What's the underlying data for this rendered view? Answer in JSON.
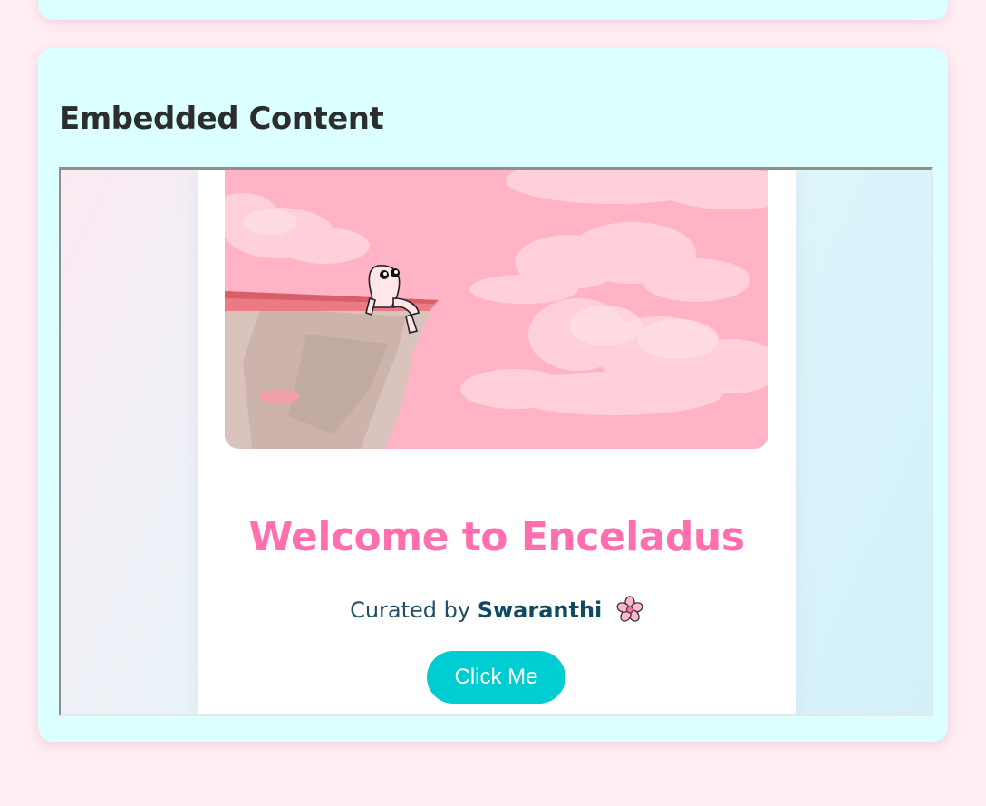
{
  "section": {
    "title": "Embedded Content"
  },
  "embed": {
    "welcome_title": "Welcome to Enceladus",
    "curated_prefix": "Curated by ",
    "curated_author": "Swaranthi",
    "flower_icon": "cherry-blossom-icon",
    "button_label": "Click Me",
    "hero_image": "pink-sky-cliff-character-illustration"
  },
  "colors": {
    "page_background": "#ffeef3",
    "card_background": "#dcffff",
    "title_pink": "#ff6fb0",
    "button_teal": "#00cdd2",
    "text_dark_teal": "#1f4e63"
  }
}
